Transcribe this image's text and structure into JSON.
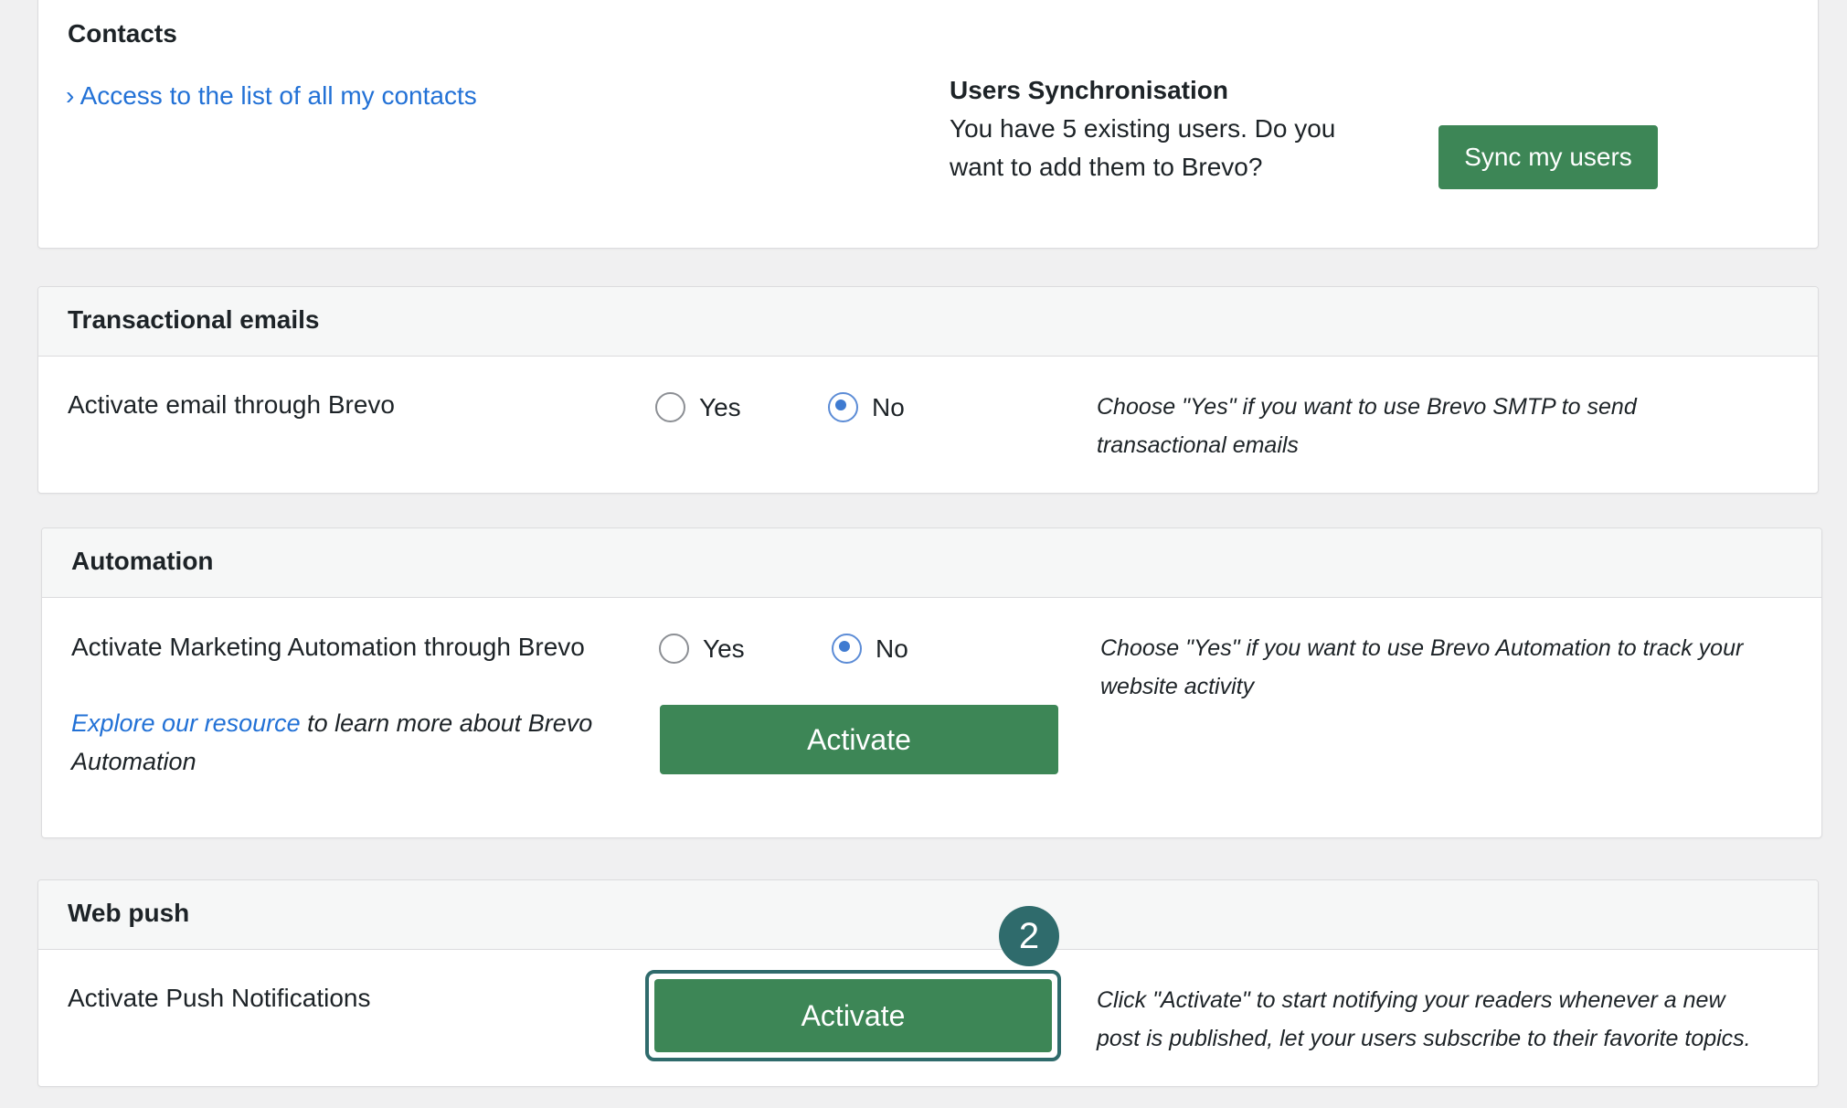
{
  "contacts": {
    "title": "Contacts",
    "link_chevron": "›",
    "link_label": "Access to the list of all my contacts",
    "sync_title": "Users Synchronisation",
    "sync_text_line1": "You have 5 existing users. Do you",
    "sync_text_line2": "want to add them to Brevo?",
    "sync_button": "Sync my users"
  },
  "transactional": {
    "title": "Transactional emails",
    "label": "Activate email through Brevo",
    "yes": "Yes",
    "no": "No",
    "selected": "No",
    "hint_line1": "Choose \"Yes\" if you want to use Brevo SMTP to send",
    "hint_line2": "transactional emails"
  },
  "automation": {
    "title": "Automation",
    "label": "Activate Marketing Automation through Brevo",
    "yes": "Yes",
    "no": "No",
    "selected": "No",
    "hint_line1": "Choose \"Yes\" if you want to use Brevo Automation to track your",
    "hint_line2": "website activity",
    "resource_link": "Explore our resource",
    "resource_text1": " to learn more about Brevo",
    "resource_text2": "Automation",
    "activate_button": "Activate"
  },
  "webpush": {
    "title": "Web push",
    "label": "Activate Push Notifications",
    "activate_button": "Activate",
    "step_badge": "2",
    "hint_line1": "Click \"Activate\" to start notifying your readers whenever a new",
    "hint_line2": "post is published, let your users subscribe to their favorite topics."
  },
  "colors": {
    "accent_green": "#3d8656",
    "link_blue": "#2271d6",
    "badge_teal": "#2f6b6c"
  }
}
